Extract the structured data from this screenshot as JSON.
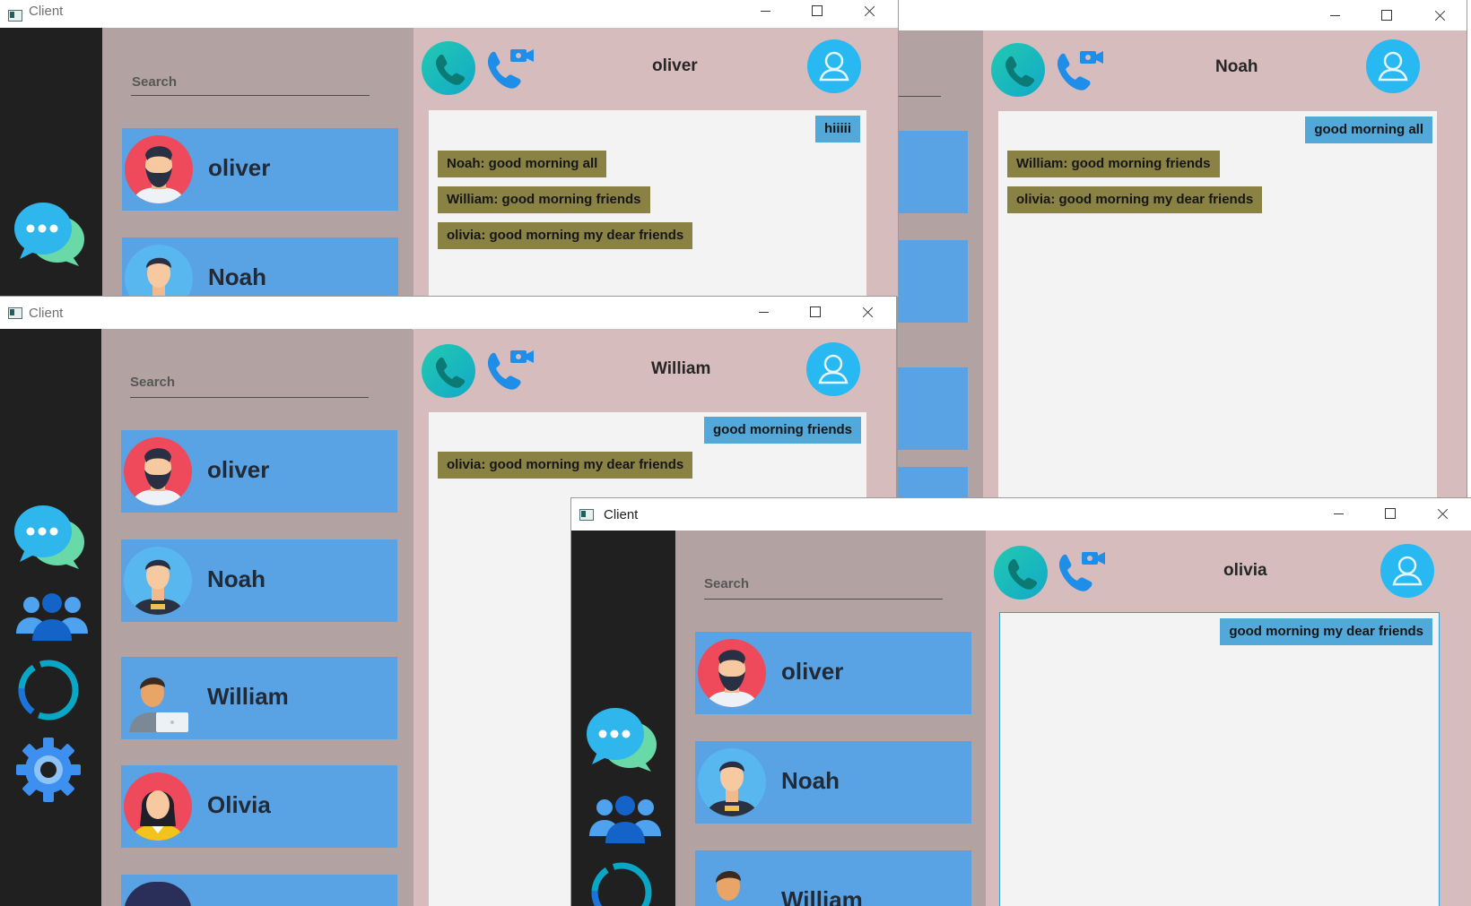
{
  "windows": {
    "noah": {
      "title": "Client",
      "chat_with": "Noah",
      "messages": [
        {
          "text": "good morning all",
          "dir": "out"
        },
        {
          "text": "William: good morning friends",
          "dir": "in"
        },
        {
          "text": "olivia: good morning my dear friends",
          "dir": "in"
        }
      ]
    },
    "oliver": {
      "title": "Client",
      "search_placeholder": "Search",
      "contacts": [
        "oliver",
        "Noah"
      ],
      "chat_with": "oliver",
      "messages": [
        {
          "text": "hiiiii",
          "dir": "out"
        },
        {
          "text": "Noah: good morning all",
          "dir": "in"
        },
        {
          "text": "William: good morning friends",
          "dir": "in"
        },
        {
          "text": "olivia: good morning my dear friends",
          "dir": "in"
        }
      ]
    },
    "william": {
      "title": "Client",
      "search_placeholder": "Search",
      "contacts": [
        "oliver",
        "Noah",
        "William",
        "Olivia"
      ],
      "chat_with": "William",
      "messages": [
        {
          "text": "good morning friends",
          "dir": "out"
        },
        {
          "text": "olivia: good morning my dear friends",
          "dir": "in"
        }
      ]
    },
    "olivia": {
      "title": "Client",
      "search_placeholder": "Search",
      "contacts": [
        "oliver",
        "Noah",
        "William"
      ],
      "chat_with": "olivia",
      "messages": [
        {
          "text": "good morning my dear friends",
          "dir": "out"
        }
      ]
    }
  },
  "icons": {
    "chat": "chat-bubbles-icon",
    "groups": "people-group-icon",
    "status": "status-ring-icon",
    "settings": "gear-icon",
    "voice_call": "phone-icon",
    "video_call": "video-call-icon",
    "profile": "user-profile-icon"
  },
  "colors": {
    "rail": "#202020",
    "contacts_panel": "#b2a2a2",
    "chat_panel": "#d6bcbc",
    "contact_card": "#59a3e5",
    "incoming_bubble": "#8a8245",
    "outgoing_bubble": "#52a8d8"
  }
}
